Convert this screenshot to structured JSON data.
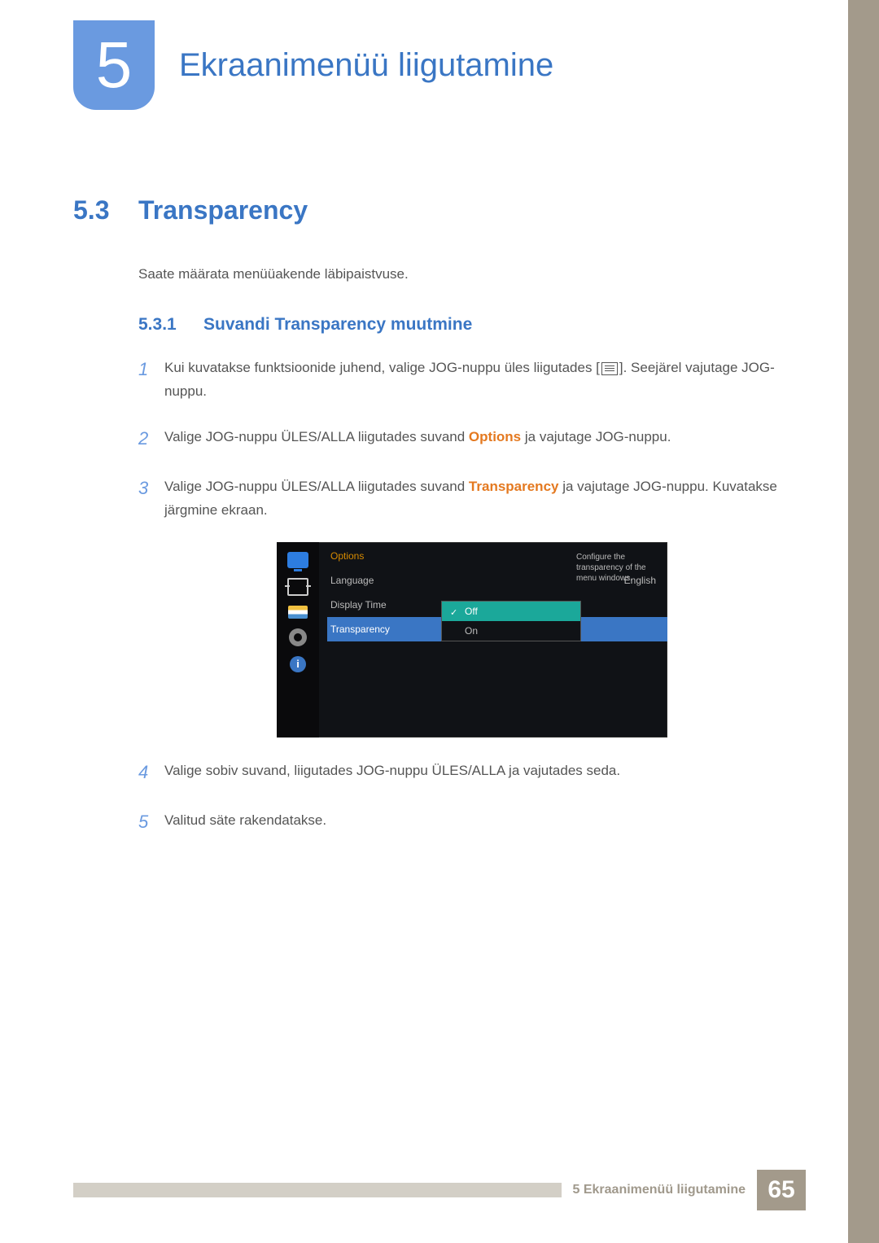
{
  "chapter": {
    "number": "5",
    "title": "Ekraanimenüü liigutamine"
  },
  "section": {
    "number": "5.3",
    "title": "Transparency",
    "intro": "Saate määrata menüüakende läbipaistvuse."
  },
  "subsection": {
    "number": "5.3.1",
    "title": "Suvandi Transparency muutmine"
  },
  "steps": {
    "s1": {
      "num": "1",
      "t1": "Kui kuvatakse funktsioonide juhend, valige JOG-nuppu üles liigutades [",
      "t2": "]. Seejärel vajutage JOG-nuppu."
    },
    "s2": {
      "num": "2",
      "t1": "Valige JOG-nuppu ÜLES/ALLA liigutades suvand ",
      "orange": "Options",
      "t2": " ja vajutage JOG-nuppu."
    },
    "s3": {
      "num": "3",
      "t1": "Valige JOG-nuppu ÜLES/ALLA liigutades suvand ",
      "orange": "Transparency",
      "t2": " ja vajutage JOG-nuppu. Kuvatakse järgmine ekraan."
    },
    "s4": {
      "num": "4",
      "text": "Valige sobiv suvand, liigutades JOG-nuppu ÜLES/ALLA ja vajutades seda."
    },
    "s5": {
      "num": "5",
      "text": "Valitud säte rakendatakse."
    }
  },
  "osd": {
    "header": "Options",
    "rows": {
      "language": "Language",
      "language_val": "English",
      "display_time": "Display Time",
      "transparency": "Transparency"
    },
    "popup": {
      "off": "Off",
      "on": "On"
    },
    "help": "Configure the transparency of the menu windows.",
    "info_glyph": "i"
  },
  "footer": {
    "label": "5 Ekraanimenüü liigutamine",
    "page": "65"
  }
}
